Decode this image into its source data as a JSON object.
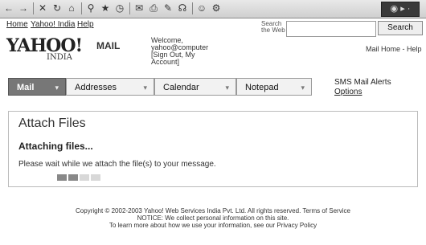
{
  "browser": {
    "toolbar_icons": [
      "back-icon",
      "forward-icon",
      "stop-icon",
      "refresh-icon",
      "home-icon",
      "search-icon",
      "favorites-icon",
      "history-icon",
      "mail-icon",
      "print-icon",
      "edit-icon",
      "discuss-icon",
      "messenger-icon",
      "gear-icon"
    ],
    "toolbar_glyphs": [
      "←",
      "→",
      "✕",
      "↻",
      "⌂",
      "⚲",
      "★",
      "◷",
      "✉",
      "⎙",
      "✎",
      "☊",
      "☺",
      "⚙"
    ]
  },
  "toplinks": [
    "Home",
    "Yahoo! India",
    "Help"
  ],
  "search": {
    "label": "Search the Web",
    "placeholder": "",
    "button_label": "Search"
  },
  "logo": {
    "text": "YAHOO!",
    "mail": "MAIL",
    "india": "INDIA"
  },
  "welcome": {
    "line1": "Welcome,",
    "line2": "yahoo@computer",
    "line3": "[Sign Out, My",
    "line4": "Account]"
  },
  "help_links": "Mail Home - Help",
  "nav": {
    "tabs": [
      "Mail",
      "Addresses",
      "Calendar",
      "Notepad"
    ],
    "arrow": "▾",
    "right_line1": "SMS Mail Alerts",
    "right_line2": "Options"
  },
  "panel": {
    "title": "Attach Files",
    "subtitle": "Attaching files...",
    "message": "Please wait while we attach the file(s) to your message.",
    "progress_fraction": 0.5
  },
  "footer": {
    "line1": "Copyright © 2002-2003 Yahoo! Web Services India Pvt. Ltd. All rights reserved. Terms of Service",
    "line2": "NOTICE: We collect personal information on this site.",
    "line3": "To learn more about how we use your information, see our Privacy Policy"
  }
}
